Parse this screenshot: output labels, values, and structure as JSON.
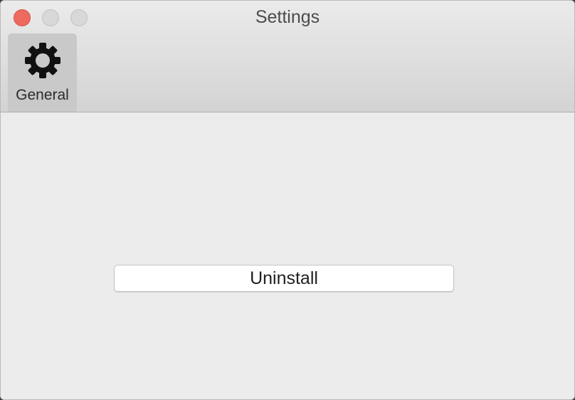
{
  "window": {
    "title": "Settings"
  },
  "toolbar": {
    "items": [
      {
        "label": "General",
        "icon": "gear-icon",
        "selected": true
      }
    ]
  },
  "content": {
    "uninstall_label": "Uninstall"
  },
  "colors": {
    "close_button": "#ee6a5e",
    "inactive_button": "#d8d8d8",
    "window_background": "#ececec",
    "selected_toolbar_item": "#c9c9c9"
  }
}
